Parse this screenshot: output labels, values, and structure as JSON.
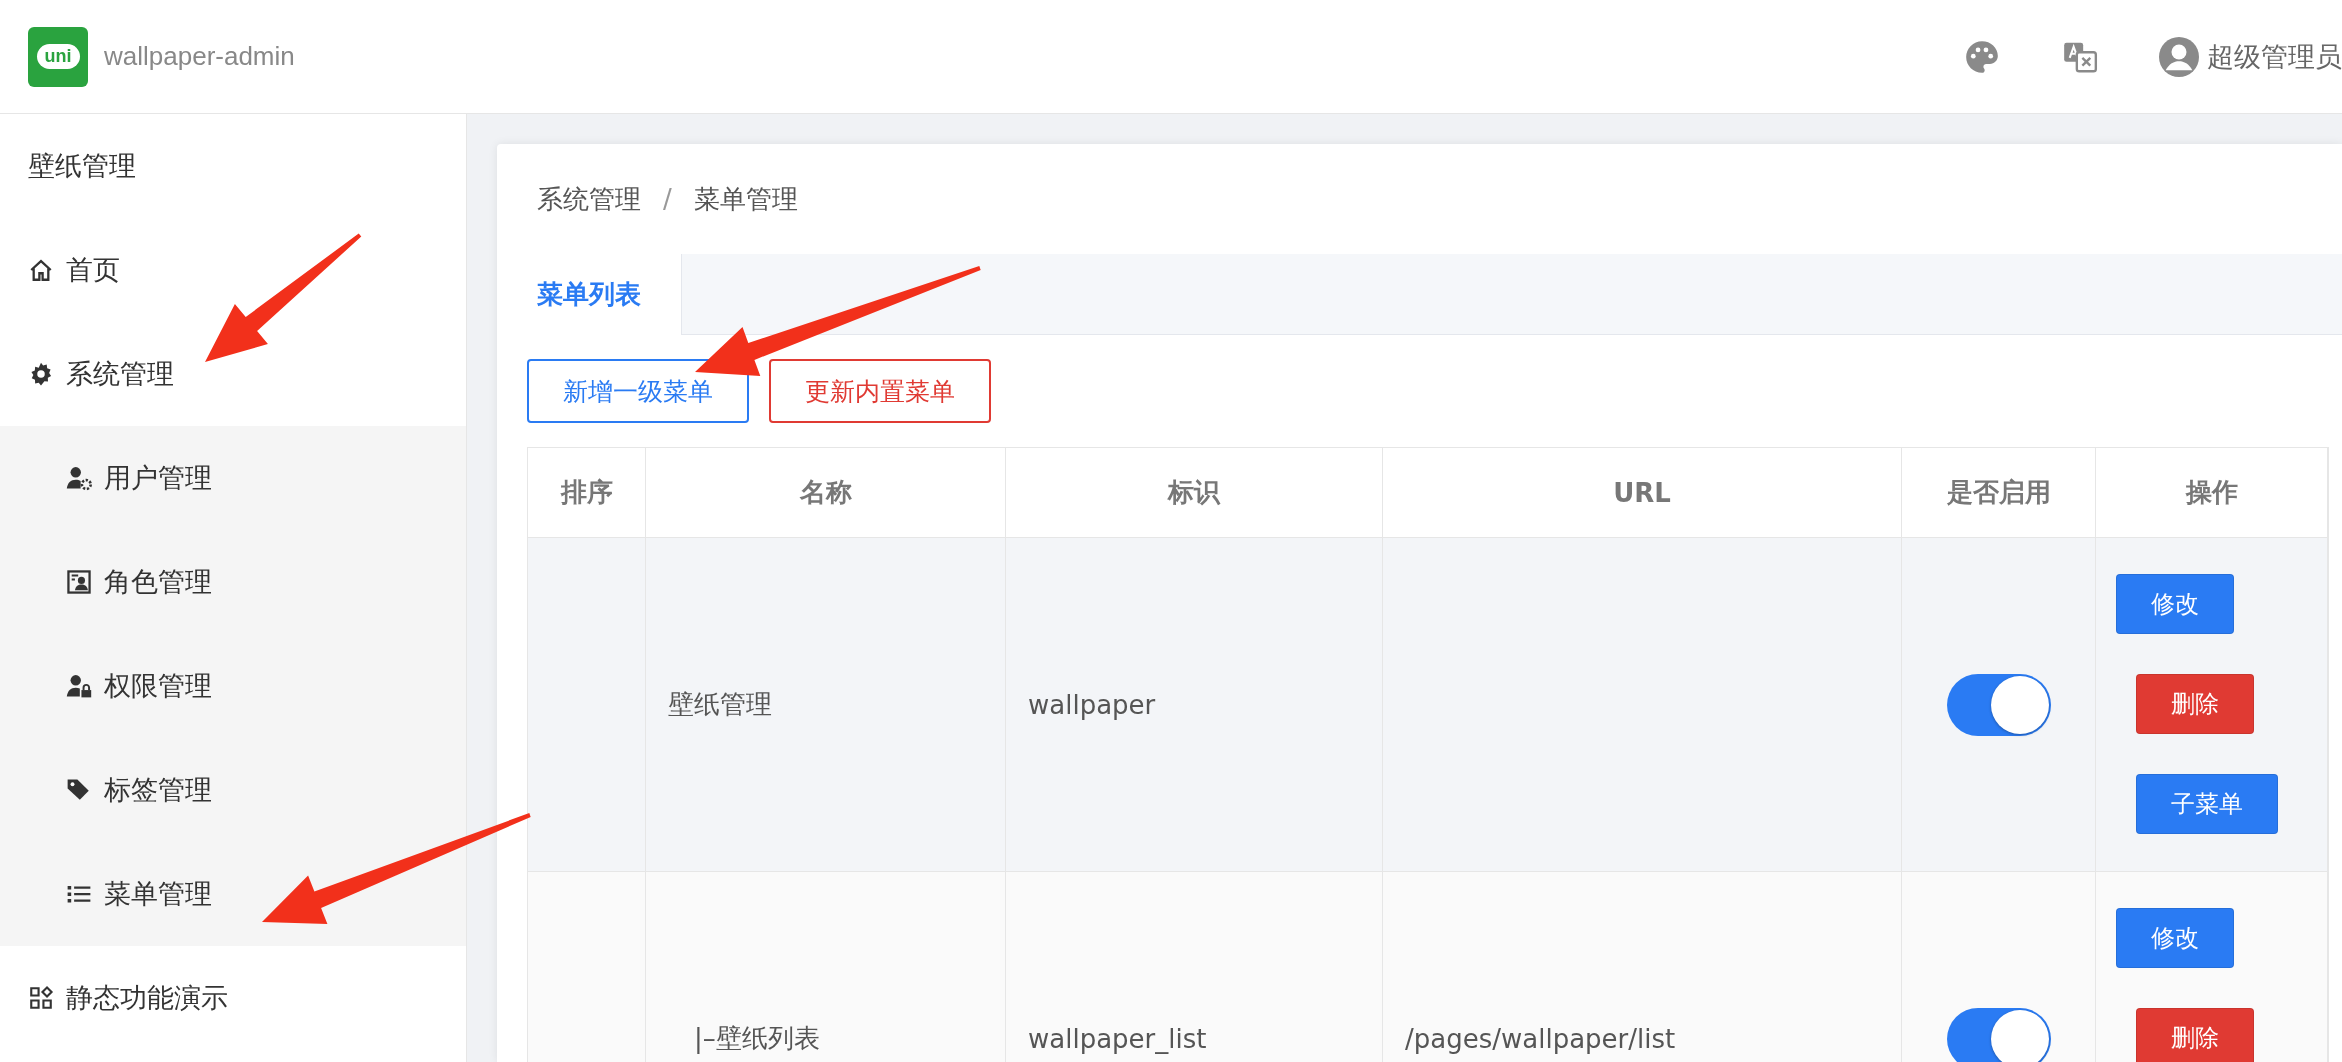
{
  "header": {
    "logo_text": "uni",
    "title": "wallpaper-admin",
    "user": "超级管理员"
  },
  "sidebar": {
    "title": "壁纸管理",
    "items": [
      {
        "label": "首页"
      },
      {
        "label": "系统管理",
        "children": [
          {
            "label": "用户管理"
          },
          {
            "label": "角色管理"
          },
          {
            "label": "权限管理"
          },
          {
            "label": "标签管理"
          },
          {
            "label": "菜单管理"
          }
        ]
      },
      {
        "label": "静态功能演示"
      }
    ]
  },
  "breadcrumb": {
    "items": [
      "系统管理",
      "菜单管理"
    ],
    "separator": "/"
  },
  "tabs": [
    {
      "label": "菜单列表",
      "selected": true
    }
  ],
  "toolbar": [
    {
      "label": "新增一级菜单",
      "kind": "primary"
    },
    {
      "label": "更新内置菜单",
      "kind": "danger"
    }
  ],
  "table": {
    "columns": [
      "排序",
      "名称",
      "标识",
      "URL",
      "是否启用",
      "操作"
    ],
    "rows": [
      {
        "name": "壁纸管理",
        "key": "wallpaper",
        "enabled": true,
        "actions": [
          {
            "label": "修改",
            "kind": "edit"
          },
          {
            "label": "删除",
            "kind": "delete"
          },
          {
            "label": "子菜单",
            "kind": "add"
          }
        ],
        "children": [
          {
            "name": "|–壁纸列表",
            "key": "wallpaper_list",
            "url": "/pages/wallpaper/list",
            "enabled": true,
            "actions": [
              {
                "label": "修改",
                "kind": "edit"
              },
              {
                "label": "删除",
                "kind": "delete"
              }
            ]
          }
        ]
      }
    ]
  },
  "annotations": [
    {
      "kind": "arrow"
    },
    {
      "kind": "arrow"
    },
    {
      "kind": "arrow"
    }
  ]
}
